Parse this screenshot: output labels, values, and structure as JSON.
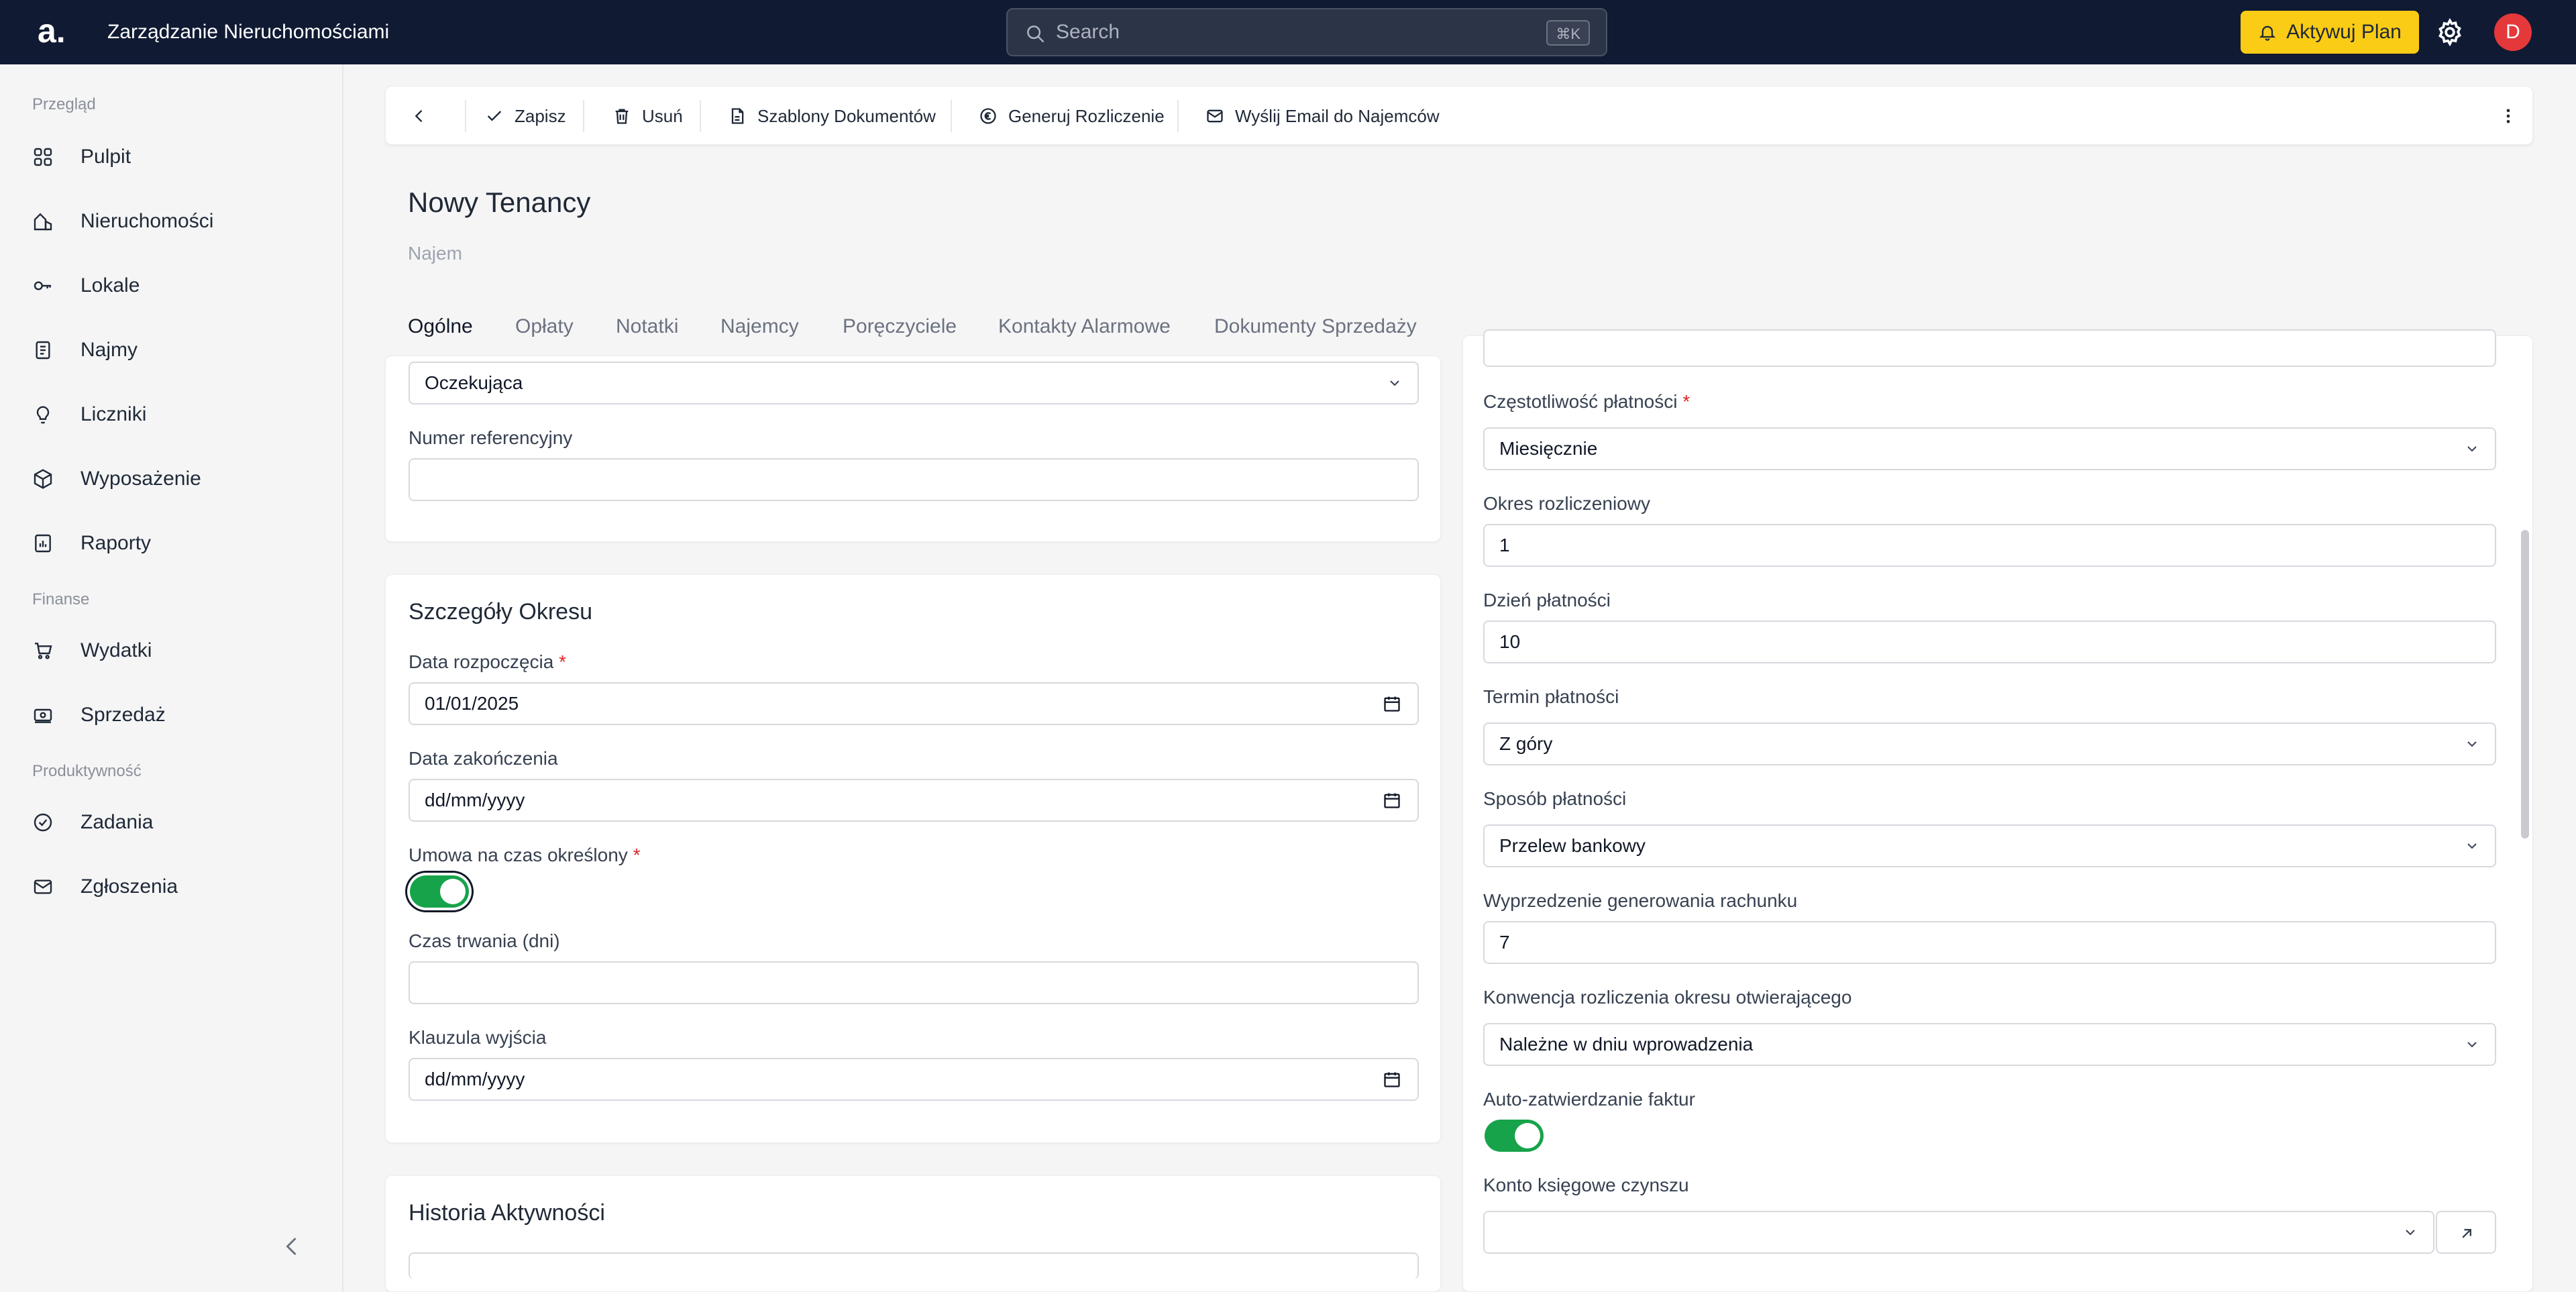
{
  "topbar": {
    "logo": "a.",
    "app_title": "Zarządzanie Nieruchomościami",
    "search_placeholder": "Search",
    "search_shortcut": "⌘K",
    "activate_label": "Aktywuj Plan",
    "avatar_initial": "D"
  },
  "sidebar": {
    "groups": [
      "Przegląd",
      "Finanse",
      "Produktywność"
    ],
    "items": [
      {
        "label": "Pulpit",
        "icon": "grid-icon"
      },
      {
        "label": "Nieruchomości",
        "icon": "building-icon"
      },
      {
        "label": "Lokale",
        "icon": "key-icon"
      },
      {
        "label": "Najmy",
        "icon": "document-icon"
      },
      {
        "label": "Liczniki",
        "icon": "lightbulb-icon"
      },
      {
        "label": "Wyposażenie",
        "icon": "box-icon"
      },
      {
        "label": "Raporty",
        "icon": "report-icon"
      },
      {
        "label": "Wydatki",
        "icon": "cart-icon"
      },
      {
        "label": "Sprzedaż",
        "icon": "money-icon"
      },
      {
        "label": "Zadania",
        "icon": "check-circle-icon"
      },
      {
        "label": "Zgłoszenia",
        "icon": "mail-icon"
      }
    ]
  },
  "toolbar": {
    "save": "Zapisz",
    "delete": "Usuń",
    "templates": "Szablony Dokumentów",
    "settlement": "Generuj Rozliczenie",
    "email": "Wyślij Email do Najemców"
  },
  "page": {
    "title": "Nowy Tenancy",
    "subtitle": "Najem"
  },
  "tabs": [
    "Ogólne",
    "Opłaty",
    "Notatki",
    "Najemcy",
    "Poręczyciele",
    "Kontakty Alarmowe",
    "Dokumenty Sprzedaży"
  ],
  "left": {
    "status_value": "Oczekująca",
    "ref_label": "Numer referencyjny",
    "ref_value": "",
    "period_title": "Szczegóły Okresu",
    "start_label": "Data rozpoczęcia",
    "start_value": "01/01/2025",
    "end_label": "Data zakończenia",
    "end_value": "dd/mm/yyyy",
    "fixed_label": "Umowa na czas określony",
    "duration_label": "Czas trwania (dni)",
    "duration_value": "",
    "exit_label": "Klauzula wyjścia",
    "exit_value": "dd/mm/yyyy",
    "history_title": "Historia Aktywności"
  },
  "right": {
    "freq_label": "Częstotliwość płatności",
    "freq_value": "Miesięcznie",
    "period_label": "Okres rozliczeniowy",
    "period_value": "1",
    "day_label": "Dzień płatności",
    "day_value": "10",
    "term_label": "Termin płatności",
    "term_value": "Z góry",
    "method_label": "Sposób płatności",
    "method_value": "Przelew bankowy",
    "advance_label": "Wyprzedzenie generowania rachunku",
    "advance_value": "7",
    "convention_label": "Konwencja rozliczenia okresu otwierającego",
    "convention_value": "Należne w dniu wprowadzenia",
    "auto_label": "Auto-zatwierdzanie faktur",
    "account_label": "Konto księgowe czynszu",
    "account_value": ""
  },
  "required_mark": "*",
  "colors": {
    "topbar": "#101a33",
    "accent_yellow": "#facc15",
    "toggle_on": "#16a34a",
    "required": "#dc2626"
  }
}
